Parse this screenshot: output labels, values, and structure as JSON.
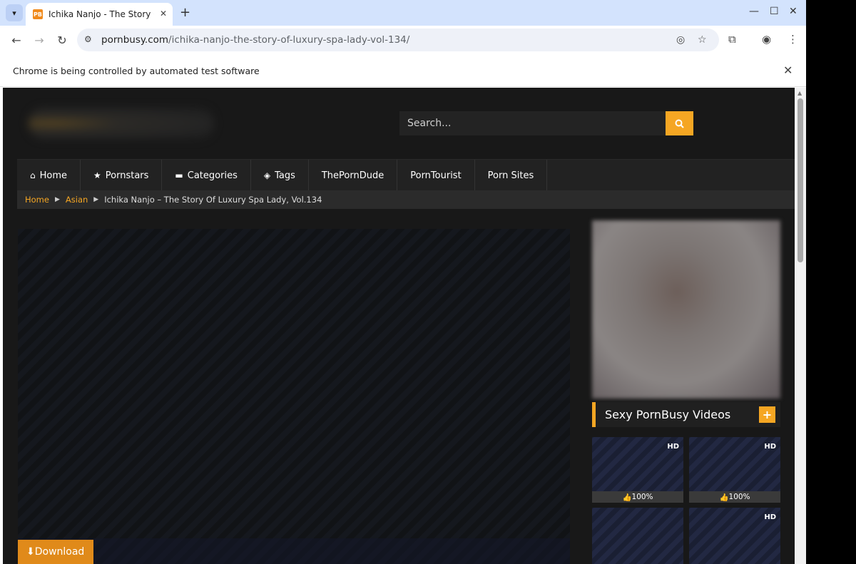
{
  "browser": {
    "tab_title": "Ichika Nanjo - The Story C",
    "favicon_text": "PB",
    "url_host": "pornbusy.com",
    "url_path": "/ichika-nanjo-the-story-of-luxury-spa-lady-vol-134/",
    "infobar_text": "Chrome is being controlled by automated test software"
  },
  "site": {
    "search_placeholder": "Search...",
    "nav": [
      {
        "label": "Home",
        "icon": "home-icon"
      },
      {
        "label": "Pornstars",
        "icon": "star-icon"
      },
      {
        "label": "Categories",
        "icon": "folder-icon"
      },
      {
        "label": "Tags",
        "icon": "tags-icon"
      },
      {
        "label": "ThePornDude",
        "icon": ""
      },
      {
        "label": "PornTourist",
        "icon": ""
      },
      {
        "label": "Porn Sites",
        "icon": ""
      }
    ],
    "breadcrumb": {
      "home": "Home",
      "category": "Asian",
      "current": "Ichika Nanjo – The Story Of Luxury Spa Lady, Vol.134"
    },
    "download_label": "⬇Download",
    "widget_title": "Sexy PornBusy Videos",
    "widget_plus": "+",
    "thumbs": [
      {
        "hd": "HD",
        "rating": "100%"
      },
      {
        "hd": "HD",
        "rating": "100%"
      },
      {
        "hd": "",
        "rating": ""
      },
      {
        "hd": "HD",
        "rating": ""
      }
    ],
    "accent_color": "#f5a623"
  }
}
